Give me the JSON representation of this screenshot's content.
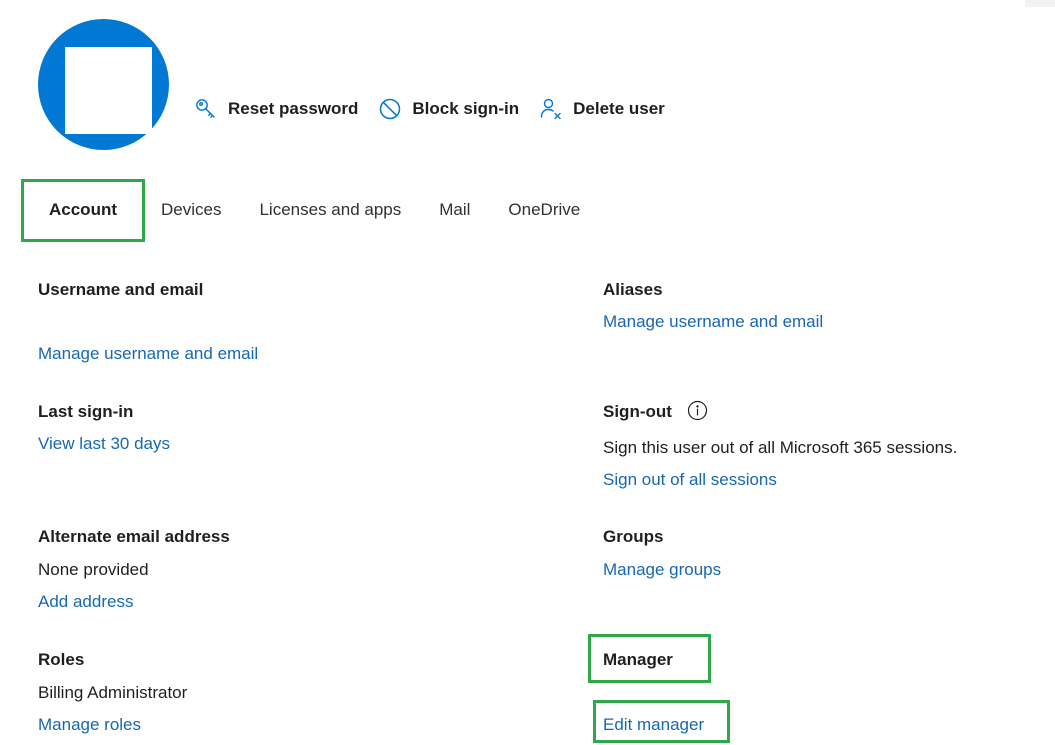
{
  "actions": {
    "reset_password": "Reset password",
    "block_signin": "Block sign-in",
    "delete_user": "Delete user"
  },
  "tabs": [
    {
      "label": "Account",
      "active": true
    },
    {
      "label": "Devices"
    },
    {
      "label": "Licenses and apps"
    },
    {
      "label": "Mail"
    },
    {
      "label": "OneDrive"
    }
  ],
  "account": {
    "username_email": {
      "title": "Username and email",
      "link": "Manage username and email"
    },
    "aliases": {
      "title": "Aliases",
      "link": "Manage username and email"
    },
    "last_signin": {
      "title": "Last sign-in",
      "link": "View last 30 days"
    },
    "signout": {
      "title": "Sign-out",
      "description": "Sign this user out of all Microsoft 365 sessions.",
      "link": "Sign out of all sessions"
    },
    "alternate_email": {
      "title": "Alternate email address",
      "value": "None provided",
      "link": "Add address"
    },
    "groups": {
      "title": "Groups",
      "link": "Manage groups"
    },
    "roles": {
      "title": "Roles",
      "value": "Billing Administrator",
      "link": "Manage roles"
    },
    "manager": {
      "title": "Manager",
      "link": "Edit manager"
    }
  },
  "colors": {
    "avatar": "#0078d4",
    "link": "#1767b3",
    "highlight": "#2ea84a",
    "text": "#201f1e"
  },
  "icons": {
    "reset_password": "key-icon",
    "block_signin": "block-icon",
    "delete_user": "person-remove-icon",
    "signout_info": "info-icon"
  }
}
